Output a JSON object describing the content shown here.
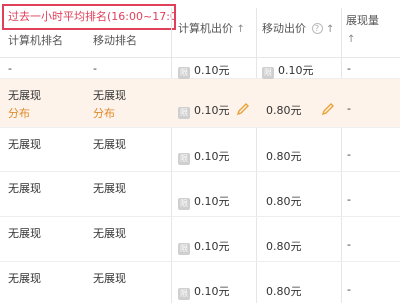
{
  "header": {
    "hint": "过去一小时平均排名(16:00~17:00)",
    "col_pc_rank": "计算机排名",
    "col_mobile_rank": "移动排名",
    "col_pc_bid": "计算机出价",
    "col_mobile_bid": "移动出价",
    "col_impressions": "展现量",
    "sort_arrow": "↑",
    "help_glyph": "?"
  },
  "tag_glyph": "限",
  "rows": [
    {
      "pc_rank": "-",
      "pc_rank_sub": "",
      "mobile_rank": "-",
      "mobile_rank_sub": "",
      "pc_bid": "0.10元",
      "mobile_bid": "0.10元",
      "impressions": "-",
      "mobile_tag": true,
      "highlight": false
    },
    {
      "pc_rank": "无展现",
      "pc_rank_sub": "分布",
      "mobile_rank": "无展现",
      "mobile_rank_sub": "分布",
      "pc_bid": "0.10元",
      "mobile_bid": "0.80元",
      "impressions": "-",
      "mobile_tag": false,
      "highlight": true
    },
    {
      "pc_rank": "无展现",
      "pc_rank_sub": "",
      "mobile_rank": "无展现",
      "mobile_rank_sub": "",
      "pc_bid": "0.10元",
      "mobile_bid": "0.80元",
      "impressions": "-",
      "mobile_tag": false,
      "highlight": false
    },
    {
      "pc_rank": "无展现",
      "pc_rank_sub": "",
      "mobile_rank": "无展现",
      "mobile_rank_sub": "",
      "pc_bid": "0.10元",
      "mobile_bid": "0.80元",
      "impressions": "-",
      "mobile_tag": false,
      "highlight": false
    },
    {
      "pc_rank": "无展现",
      "pc_rank_sub": "",
      "mobile_rank": "无展现",
      "mobile_rank_sub": "",
      "pc_bid": "0.10元",
      "mobile_bid": "0.80元",
      "impressions": "-",
      "mobile_tag": false,
      "highlight": false
    },
    {
      "pc_rank": "无展现",
      "pc_rank_sub": "",
      "mobile_rank": "无展现",
      "mobile_rank_sub": "",
      "pc_bid": "0.10元",
      "mobile_bid": "0.80元",
      "impressions": "-",
      "mobile_tag": false,
      "highlight": false
    }
  ],
  "colors": {
    "hint_border": "#e0405a",
    "highlight_row": "#fdf3ea",
    "link_orange": "#e08a2a",
    "edit_pencil": "#e8a23a"
  },
  "icons": {
    "edit": "pencil-icon",
    "help": "help-circle-icon",
    "tag": "bid-tag-icon"
  }
}
